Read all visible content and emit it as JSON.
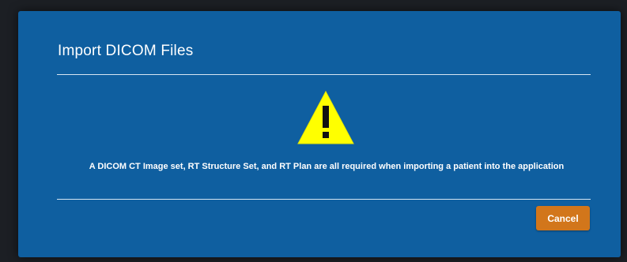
{
  "dialog": {
    "title": "Import DICOM Files",
    "icon": "warning-triangle-icon",
    "message": "A DICOM CT Image set, RT Structure Set, and RT Plan are all required when importing a patient into the application",
    "cancel_label": "Cancel"
  },
  "colors": {
    "dialog_background": "#0f5fa0",
    "warning_fill": "#ffff00",
    "cancel_button": "#d2761b"
  }
}
